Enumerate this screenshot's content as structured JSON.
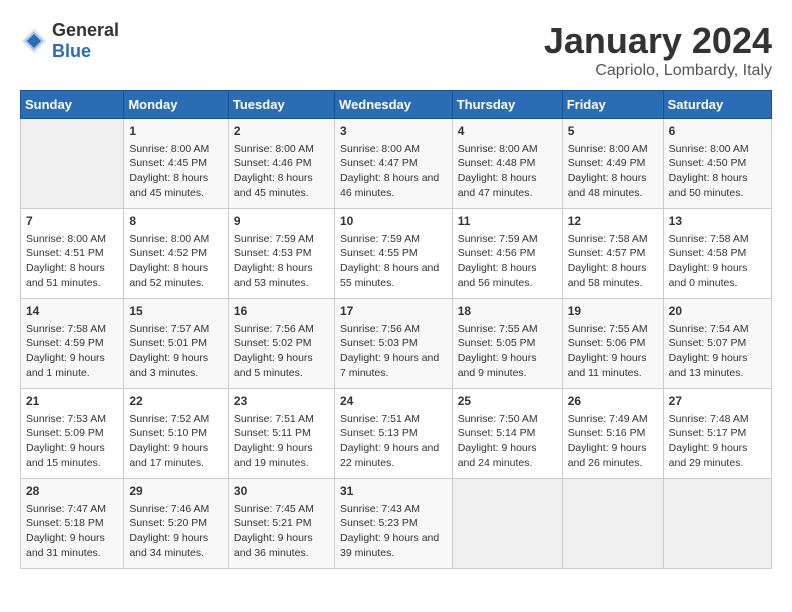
{
  "logo": {
    "general": "General",
    "blue": "Blue"
  },
  "header": {
    "month": "January 2024",
    "location": "Capriolo, Lombardy, Italy"
  },
  "weekdays": [
    "Sunday",
    "Monday",
    "Tuesday",
    "Wednesday",
    "Thursday",
    "Friday",
    "Saturday"
  ],
  "weeks": [
    [
      {
        "day": "",
        "sunrise": "",
        "sunset": "",
        "daylight": ""
      },
      {
        "day": "1",
        "sunrise": "Sunrise: 8:00 AM",
        "sunset": "Sunset: 4:45 PM",
        "daylight": "Daylight: 8 hours and 45 minutes."
      },
      {
        "day": "2",
        "sunrise": "Sunrise: 8:00 AM",
        "sunset": "Sunset: 4:46 PM",
        "daylight": "Daylight: 8 hours and 45 minutes."
      },
      {
        "day": "3",
        "sunrise": "Sunrise: 8:00 AM",
        "sunset": "Sunset: 4:47 PM",
        "daylight": "Daylight: 8 hours and 46 minutes."
      },
      {
        "day": "4",
        "sunrise": "Sunrise: 8:00 AM",
        "sunset": "Sunset: 4:48 PM",
        "daylight": "Daylight: 8 hours and 47 minutes."
      },
      {
        "day": "5",
        "sunrise": "Sunrise: 8:00 AM",
        "sunset": "Sunset: 4:49 PM",
        "daylight": "Daylight: 8 hours and 48 minutes."
      },
      {
        "day": "6",
        "sunrise": "Sunrise: 8:00 AM",
        "sunset": "Sunset: 4:50 PM",
        "daylight": "Daylight: 8 hours and 50 minutes."
      }
    ],
    [
      {
        "day": "7",
        "sunrise": "Sunrise: 8:00 AM",
        "sunset": "Sunset: 4:51 PM",
        "daylight": "Daylight: 8 hours and 51 minutes."
      },
      {
        "day": "8",
        "sunrise": "Sunrise: 8:00 AM",
        "sunset": "Sunset: 4:52 PM",
        "daylight": "Daylight: 8 hours and 52 minutes."
      },
      {
        "day": "9",
        "sunrise": "Sunrise: 7:59 AM",
        "sunset": "Sunset: 4:53 PM",
        "daylight": "Daylight: 8 hours and 53 minutes."
      },
      {
        "day": "10",
        "sunrise": "Sunrise: 7:59 AM",
        "sunset": "Sunset: 4:55 PM",
        "daylight": "Daylight: 8 hours and 55 minutes."
      },
      {
        "day": "11",
        "sunrise": "Sunrise: 7:59 AM",
        "sunset": "Sunset: 4:56 PM",
        "daylight": "Daylight: 8 hours and 56 minutes."
      },
      {
        "day": "12",
        "sunrise": "Sunrise: 7:58 AM",
        "sunset": "Sunset: 4:57 PM",
        "daylight": "Daylight: 8 hours and 58 minutes."
      },
      {
        "day": "13",
        "sunrise": "Sunrise: 7:58 AM",
        "sunset": "Sunset: 4:58 PM",
        "daylight": "Daylight: 9 hours and 0 minutes."
      }
    ],
    [
      {
        "day": "14",
        "sunrise": "Sunrise: 7:58 AM",
        "sunset": "Sunset: 4:59 PM",
        "daylight": "Daylight: 9 hours and 1 minute."
      },
      {
        "day": "15",
        "sunrise": "Sunrise: 7:57 AM",
        "sunset": "Sunset: 5:01 PM",
        "daylight": "Daylight: 9 hours and 3 minutes."
      },
      {
        "day": "16",
        "sunrise": "Sunrise: 7:56 AM",
        "sunset": "Sunset: 5:02 PM",
        "daylight": "Daylight: 9 hours and 5 minutes."
      },
      {
        "day": "17",
        "sunrise": "Sunrise: 7:56 AM",
        "sunset": "Sunset: 5:03 PM",
        "daylight": "Daylight: 9 hours and 7 minutes."
      },
      {
        "day": "18",
        "sunrise": "Sunrise: 7:55 AM",
        "sunset": "Sunset: 5:05 PM",
        "daylight": "Daylight: 9 hours and 9 minutes."
      },
      {
        "day": "19",
        "sunrise": "Sunrise: 7:55 AM",
        "sunset": "Sunset: 5:06 PM",
        "daylight": "Daylight: 9 hours and 11 minutes."
      },
      {
        "day": "20",
        "sunrise": "Sunrise: 7:54 AM",
        "sunset": "Sunset: 5:07 PM",
        "daylight": "Daylight: 9 hours and 13 minutes."
      }
    ],
    [
      {
        "day": "21",
        "sunrise": "Sunrise: 7:53 AM",
        "sunset": "Sunset: 5:09 PM",
        "daylight": "Daylight: 9 hours and 15 minutes."
      },
      {
        "day": "22",
        "sunrise": "Sunrise: 7:52 AM",
        "sunset": "Sunset: 5:10 PM",
        "daylight": "Daylight: 9 hours and 17 minutes."
      },
      {
        "day": "23",
        "sunrise": "Sunrise: 7:51 AM",
        "sunset": "Sunset: 5:11 PM",
        "daylight": "Daylight: 9 hours and 19 minutes."
      },
      {
        "day": "24",
        "sunrise": "Sunrise: 7:51 AM",
        "sunset": "Sunset: 5:13 PM",
        "daylight": "Daylight: 9 hours and 22 minutes."
      },
      {
        "day": "25",
        "sunrise": "Sunrise: 7:50 AM",
        "sunset": "Sunset: 5:14 PM",
        "daylight": "Daylight: 9 hours and 24 minutes."
      },
      {
        "day": "26",
        "sunrise": "Sunrise: 7:49 AM",
        "sunset": "Sunset: 5:16 PM",
        "daylight": "Daylight: 9 hours and 26 minutes."
      },
      {
        "day": "27",
        "sunrise": "Sunrise: 7:48 AM",
        "sunset": "Sunset: 5:17 PM",
        "daylight": "Daylight: 9 hours and 29 minutes."
      }
    ],
    [
      {
        "day": "28",
        "sunrise": "Sunrise: 7:47 AM",
        "sunset": "Sunset: 5:18 PM",
        "daylight": "Daylight: 9 hours and 31 minutes."
      },
      {
        "day": "29",
        "sunrise": "Sunrise: 7:46 AM",
        "sunset": "Sunset: 5:20 PM",
        "daylight": "Daylight: 9 hours and 34 minutes."
      },
      {
        "day": "30",
        "sunrise": "Sunrise: 7:45 AM",
        "sunset": "Sunset: 5:21 PM",
        "daylight": "Daylight: 9 hours and 36 minutes."
      },
      {
        "day": "31",
        "sunrise": "Sunrise: 7:43 AM",
        "sunset": "Sunset: 5:23 PM",
        "daylight": "Daylight: 9 hours and 39 minutes."
      },
      {
        "day": "",
        "sunrise": "",
        "sunset": "",
        "daylight": ""
      },
      {
        "day": "",
        "sunrise": "",
        "sunset": "",
        "daylight": ""
      },
      {
        "day": "",
        "sunrise": "",
        "sunset": "",
        "daylight": ""
      }
    ]
  ]
}
